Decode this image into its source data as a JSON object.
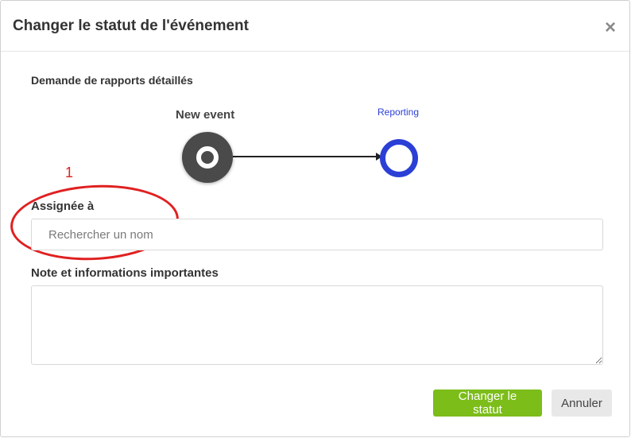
{
  "modal": {
    "title": "Changer le statut de l'événement",
    "close_symbol": "×"
  },
  "workflow": {
    "name": "Demande de rapports détaillés",
    "current_step": "New event",
    "next_step": "Reporting",
    "colors": {
      "current": "#4a4a4a",
      "next": "#2b3fd6"
    }
  },
  "annotation": {
    "number": "1",
    "color": "#e02020"
  },
  "assignee": {
    "label": "Assignée à",
    "placeholder": "Rechercher un nom",
    "value": ""
  },
  "notes": {
    "label": "Note et informations importantes",
    "value": ""
  },
  "buttons": {
    "submit": "Changer le statut",
    "cancel": "Annuler",
    "submit_color": "#7cbd1a"
  }
}
